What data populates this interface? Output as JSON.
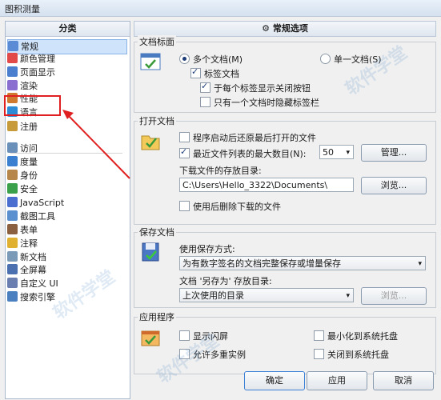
{
  "window": {
    "title": "图积测量"
  },
  "left": {
    "header": "分类",
    "items": [
      {
        "label": "常规",
        "icon": "settings-icon",
        "color": "#5b8bd4"
      },
      {
        "label": "颜色管理",
        "icon": "color-icon",
        "color": "#e24a4a"
      },
      {
        "label": "页面显示",
        "icon": "page-display-icon",
        "color": "#4a7fd0"
      },
      {
        "label": "渲染",
        "icon": "render-icon",
        "color": "#8a6fd0"
      },
      {
        "label": "性能",
        "icon": "performance-icon",
        "color": "#d07a30"
      },
      {
        "label": "语言",
        "icon": "globe-icon",
        "color": "#2e8bd6"
      },
      {
        "label": "注册",
        "icon": "user-icon",
        "color": "#c79a3a"
      },
      {
        "label": "访问",
        "icon": "access-icon",
        "color": "#6a8fb8"
      },
      {
        "label": "度量",
        "icon": "ruler-icon",
        "color": "#3a7fd0"
      },
      {
        "label": "身份",
        "icon": "identity-icon",
        "color": "#b6864a"
      },
      {
        "label": "安全",
        "icon": "shield-icon",
        "color": "#3aa04a"
      },
      {
        "label": "JavaScript",
        "icon": "javascript-icon",
        "color": "#4a6fd0"
      },
      {
        "label": "截图工具",
        "icon": "screenshot-icon",
        "color": "#5a8fd0"
      },
      {
        "label": "表单",
        "icon": "form-icon",
        "color": "#8a6040"
      },
      {
        "label": "注释",
        "icon": "comment-icon",
        "color": "#e0b030"
      },
      {
        "label": "新文档",
        "icon": "new-document-icon",
        "color": "#7a9ab8"
      },
      {
        "label": "全屏幕",
        "icon": "fullscreen-icon",
        "color": "#4a70b0"
      },
      {
        "label": "自定义 UI",
        "icon": "custom-ui-icon",
        "color": "#6a7fb0"
      },
      {
        "label": "搜索引擎",
        "icon": "search-engine-icon",
        "color": "#4a80c0"
      }
    ]
  },
  "right": {
    "header": "常规选项",
    "doc_panel": {
      "title": "文档标面",
      "multi_doc": "多个文档(M)",
      "single_doc": "单一文档(S)",
      "tab_doc": "标签文档",
      "close_btn_each_tab": "于每个标签显示关闭按钮",
      "hide_tab_single": "只有一个文档时隐藏标签栏"
    },
    "open_doc": {
      "title": "打开文档",
      "restore_last": "程序启动后还原最后打开的文件",
      "recent_max": "最近文件列表的最大数目(N):",
      "recent_value": "50",
      "manage_button": "管理...",
      "download_dir_label": "下载文件的存放目录:",
      "download_dir_value": "C:\\Users\\Hello_3322\\Documents\\",
      "browse_button": "浏览...",
      "delete_after_use": "使用后删除下载的文件"
    },
    "save_doc": {
      "title": "保存文档",
      "save_mode_label": "使用保存方式:",
      "save_mode_value": "为有数字签名的文档完整保存或增量保存",
      "save_as_label": "文档 '另存为' 存放目录:",
      "save_as_value": "上次使用的目录",
      "browse_button": "浏览..."
    },
    "app": {
      "title": "应用程序",
      "splash": "显示闪屏",
      "multi_instance": "允许多重实例",
      "min_to_tray": "最小化到系统托盘",
      "close_to_tray": "关闭到系统托盘"
    }
  },
  "footer": {
    "ok": "确定",
    "apply": "应用",
    "cancel": "取消"
  },
  "watermark": "软件学堂"
}
